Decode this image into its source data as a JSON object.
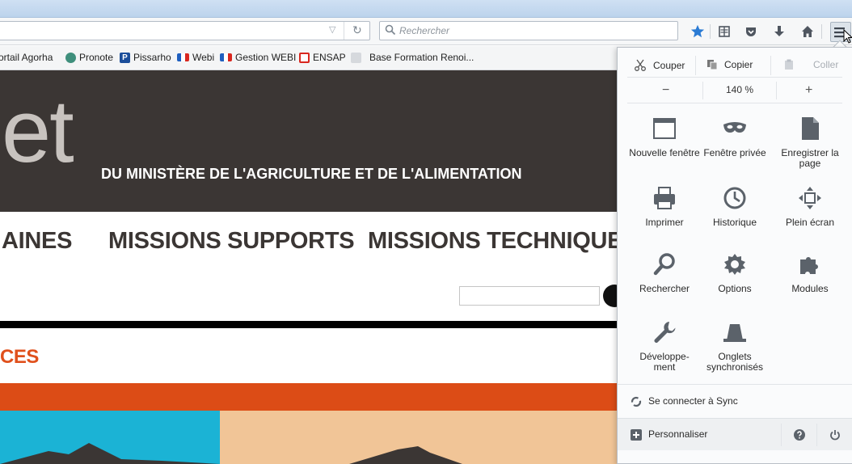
{
  "toolbar": {
    "search_placeholder": "Rechercher"
  },
  "bookmarks": [
    {
      "label": "ortail Agorha",
      "color": "#ffffff"
    },
    {
      "label": "Pronote",
      "color": "#3f8f7c"
    },
    {
      "label": "Pissarho",
      "color": "#1b4e9a"
    },
    {
      "label": "Webi",
      "color": "#1f5fbf"
    },
    {
      "label": "Gestion WEBI",
      "color": "#1f5fbf"
    },
    {
      "label": "ENSAP",
      "color": "#d9271f"
    },
    {
      "label": "Base Formation Renoi...",
      "color": "#d6d9dd"
    }
  ],
  "page": {
    "hero_big": "et",
    "hero_sub": "DU MINISTÈRE DE L'AGRICULTURE ET DE L'ALIMENTATION",
    "nav": [
      "AINES",
      "MISSIONS SUPPORTS",
      "MISSIONS TECHNIQUES"
    ],
    "section_head": "CES"
  },
  "menu": {
    "cut": "Couper",
    "copy": "Copier",
    "paste": "Coller",
    "zoom_minus": "−",
    "zoom_value": "140 %",
    "zoom_plus": "+",
    "items": [
      {
        "label": "Nouvelle fenêtre",
        "icon": "window-icon"
      },
      {
        "label": "Fenêtre privée",
        "icon": "mask-icon"
      },
      {
        "label": "Enregistrer la page",
        "icon": "page-icon"
      },
      {
        "label": "Imprimer",
        "icon": "printer-icon"
      },
      {
        "label": "Historique",
        "icon": "clock-icon"
      },
      {
        "label": "Plein écran",
        "icon": "fullscreen-icon"
      },
      {
        "label": "Rechercher",
        "icon": "magnifier-icon"
      },
      {
        "label": "Options",
        "icon": "gear-icon"
      },
      {
        "label": "Modules",
        "icon": "puzzle-icon"
      },
      {
        "label": "Développe-ment",
        "icon": "wrench-icon"
      },
      {
        "label": "Onglets synchronisés",
        "icon": "sync-tabs-icon"
      }
    ],
    "sync": "Se connecter à Sync",
    "customize": "Personnaliser"
  },
  "colors": {
    "accent_blue": "#2b7bd4",
    "hero_bg": "#3b3634",
    "orange": "#dc4c16",
    "section_head": "#e0501c"
  }
}
